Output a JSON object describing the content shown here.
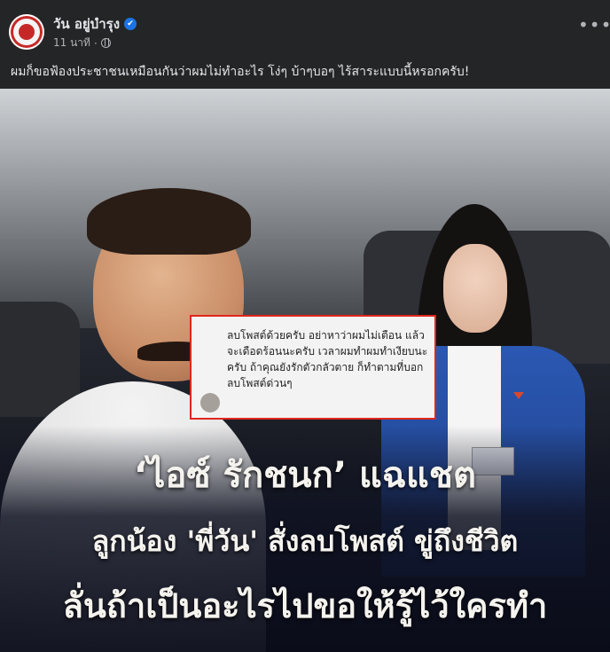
{
  "post": {
    "author": "วัน อยู่บำรุง",
    "verified_glyph": "✔",
    "time": "11 นาที",
    "separator": "·",
    "privacy_icon": "globe-icon",
    "more_label": "•••",
    "caption": "ผมก็ขอฟ้องประชาชนเหมือนกันว่าผมไม่ทำอะไร โง่ๆ บ้าๆบอๆ ไร้สาระแบบนี้หรอกครับ!"
  },
  "image": {
    "chat_message": "ลบโพสต์ด้วยครับ อย่าหาว่าผมไม่เตือน แล้วจะเดือดร้อนนะครับ เวลาผมทำผมทำเงียบนะครับ ถ้าคุณยังรักตัวกลัวตาย ก็ทำตามที่บอก ลบโพสต์ด่วนๆ",
    "headline_1": "‘ไอซ์ รักชนก’ แฉแชต",
    "headline_2": "ลูกน้อง 'พี่วัน' สั่งลบโพสต์ ขู่ถึงชีวิต",
    "headline_3": "ลั่นถ้าเป็นอะไรไปขอให้รู้ไว้ใครทำ"
  },
  "colors": {
    "background": "#242526",
    "verified": "#1b74e4",
    "chat_border": "#e0261d"
  }
}
